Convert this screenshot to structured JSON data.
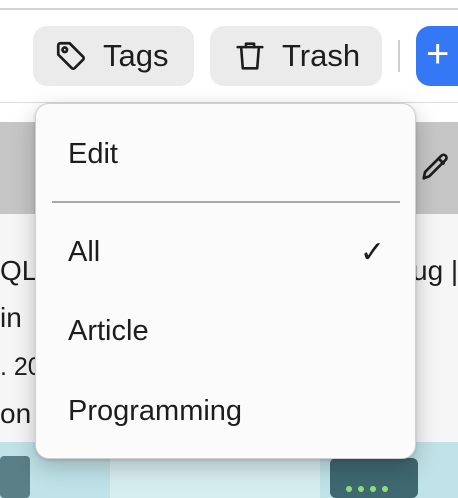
{
  "toolbar": {
    "tags_label": "Tags",
    "trash_label": "Trash",
    "add_label": "+"
  },
  "background": {
    "left_lines": [
      "QL",
      "in",
      ". 20",
      "on"
    ],
    "right_lines": [
      "ug |"
    ]
  },
  "menu": {
    "edit_label": "Edit",
    "items": [
      {
        "label": "All",
        "checked": true
      },
      {
        "label": "Article",
        "checked": false
      },
      {
        "label": "Programming",
        "checked": false
      }
    ],
    "check_glyph": "✓"
  },
  "colors": {
    "accent": "#3478f6",
    "button_bg": "#ebebeb",
    "menu_bg": "#fbfbfb"
  },
  "icons": {
    "tags": "tag-icon",
    "trash": "trash-icon",
    "edit_card": "pencil-icon",
    "add": "plus-icon"
  }
}
